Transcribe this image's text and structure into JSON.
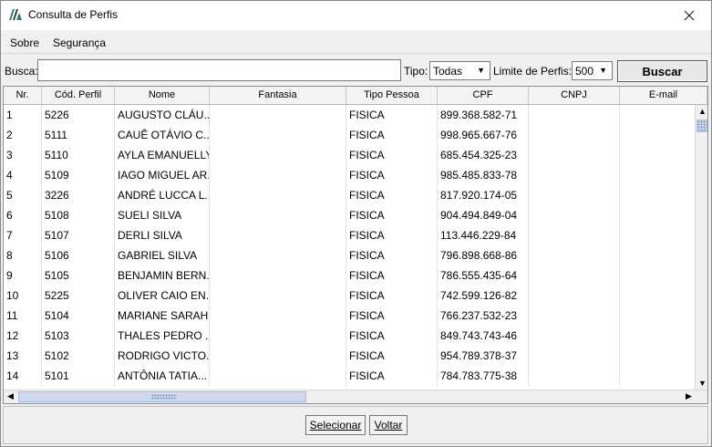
{
  "window": {
    "title": "Consulta de Perfis"
  },
  "menu": {
    "items": [
      "Sobre",
      "Segurança"
    ]
  },
  "search": {
    "busca_label": "Busca:",
    "busca_value": "",
    "tipo_label": "Tipo:",
    "tipo_value": "Todas",
    "limite_label": "Limite de Perfis:",
    "limite_value": "500",
    "buscar_label": "Buscar"
  },
  "grid": {
    "columns": [
      "Nr.",
      "Cód. Perfil",
      "Nome",
      "Fantasia",
      "Tipo Pessoa",
      "CPF",
      "CNPJ",
      "E-mail"
    ],
    "rows": [
      [
        "1",
        "5226",
        "AUGUSTO CLÁU...",
        "",
        "FISICA",
        "899.368.582-71",
        "",
        ""
      ],
      [
        "2",
        "5111",
        "CAUÊ OTÁVIO C...",
        "",
        "FISICA",
        "998.965.667-76",
        "",
        ""
      ],
      [
        "3",
        "5110",
        "AYLA EMANUELLY",
        "",
        "FISICA",
        "685.454.325-23",
        "",
        ""
      ],
      [
        "4",
        "5109",
        "IAGO MIGUEL AR...",
        "",
        "FISICA",
        "985.485.833-78",
        "",
        ""
      ],
      [
        "5",
        "3226",
        "ANDRÉ LUCCA L...",
        "",
        "FISICA",
        "817.920.174-05",
        "",
        ""
      ],
      [
        "6",
        "5108",
        "SUELI SILVA",
        "",
        "FISICA",
        "904.494.849-04",
        "",
        ""
      ],
      [
        "7",
        "5107",
        "DERLI SILVA",
        "",
        "FISICA",
        "113.446.229-84",
        "",
        ""
      ],
      [
        "8",
        "5106",
        "GABRIEL SILVA",
        "",
        "FISICA",
        "796.898.668-86",
        "",
        ""
      ],
      [
        "9",
        "5105",
        "BENJAMIN BERN...",
        "",
        "FISICA",
        "786.555.435-64",
        "",
        ""
      ],
      [
        "10",
        "5225",
        "OLIVER CAIO EN...",
        "",
        "FISICA",
        "742.599.126-82",
        "",
        ""
      ],
      [
        "11",
        "5104",
        "MARIANE SARAH",
        "",
        "FISICA",
        "766.237.532-23",
        "",
        ""
      ],
      [
        "12",
        "5103",
        "THALES PEDRO ...",
        "",
        "FISICA",
        "849.743.743-46",
        "",
        ""
      ],
      [
        "13",
        "5102",
        "RODRIGO VICTO...",
        "",
        "FISICA",
        "954.789.378-37",
        "",
        ""
      ],
      [
        "14",
        "5101",
        "ANTÔNIA TATIA...",
        "",
        "FISICA",
        "784.783.775-38",
        "",
        ""
      ]
    ]
  },
  "actions": {
    "selecionar_label": "Selecionar",
    "voltar_label": "Voltar"
  },
  "colors": {
    "window_bg": "#f0f0f0",
    "grid_bg": "#ffffff",
    "scroll_thumb": "#cdd9ee",
    "icon_accent": "#2e7d6b"
  },
  "icons": {
    "app": "app-logo-icon",
    "close": "close-icon",
    "dropdown": "chevron-down-icon",
    "scroll_up": "arrow-up-icon",
    "scroll_down": "arrow-down-icon",
    "scroll_left": "arrow-left-icon",
    "scroll_right": "arrow-right-icon"
  }
}
